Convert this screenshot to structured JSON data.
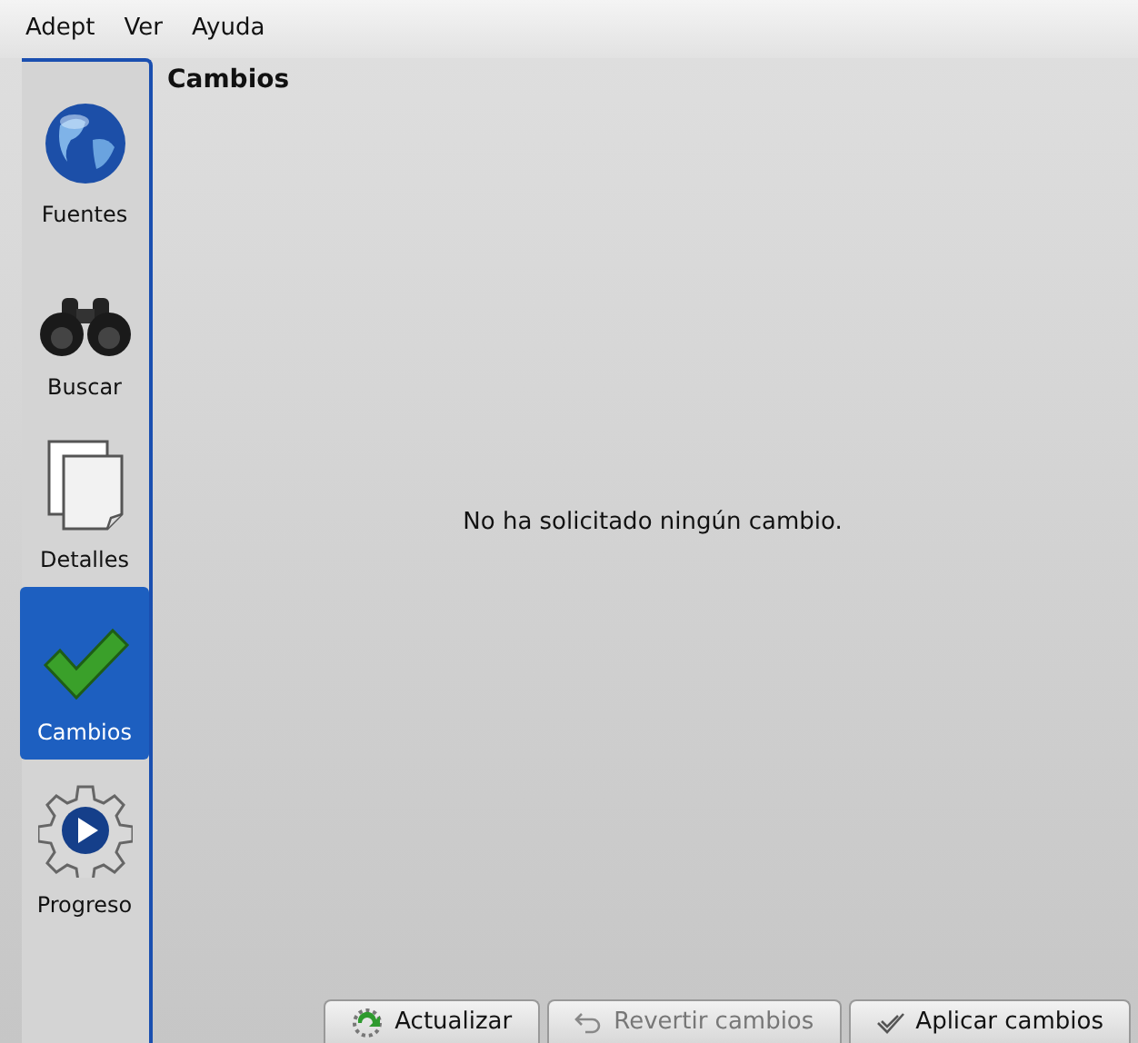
{
  "menu": [
    {
      "label": "Adept"
    },
    {
      "label": "Ver"
    },
    {
      "label": "Ayuda"
    }
  ],
  "sidebar": {
    "items": [
      {
        "label": "Fuentes",
        "kind": "globe",
        "selected": false
      },
      {
        "label": "Buscar",
        "kind": "binoculars",
        "selected": false
      },
      {
        "label": "Detalles",
        "kind": "pages",
        "selected": false
      },
      {
        "label": "Cambios",
        "kind": "check",
        "selected": true
      },
      {
        "label": "Progreso",
        "kind": "gear",
        "selected": false
      }
    ]
  },
  "page": {
    "title": "Cambios",
    "message": "No ha solicitado ningún cambio."
  },
  "buttons": [
    {
      "label": "Actualizar",
      "kind": "refresh",
      "disabled": false
    },
    {
      "label": "Revertir cambios",
      "kind": "undo",
      "disabled": true
    },
    {
      "label": "Aplicar cambios",
      "kind": "apply",
      "disabled": false
    }
  ]
}
